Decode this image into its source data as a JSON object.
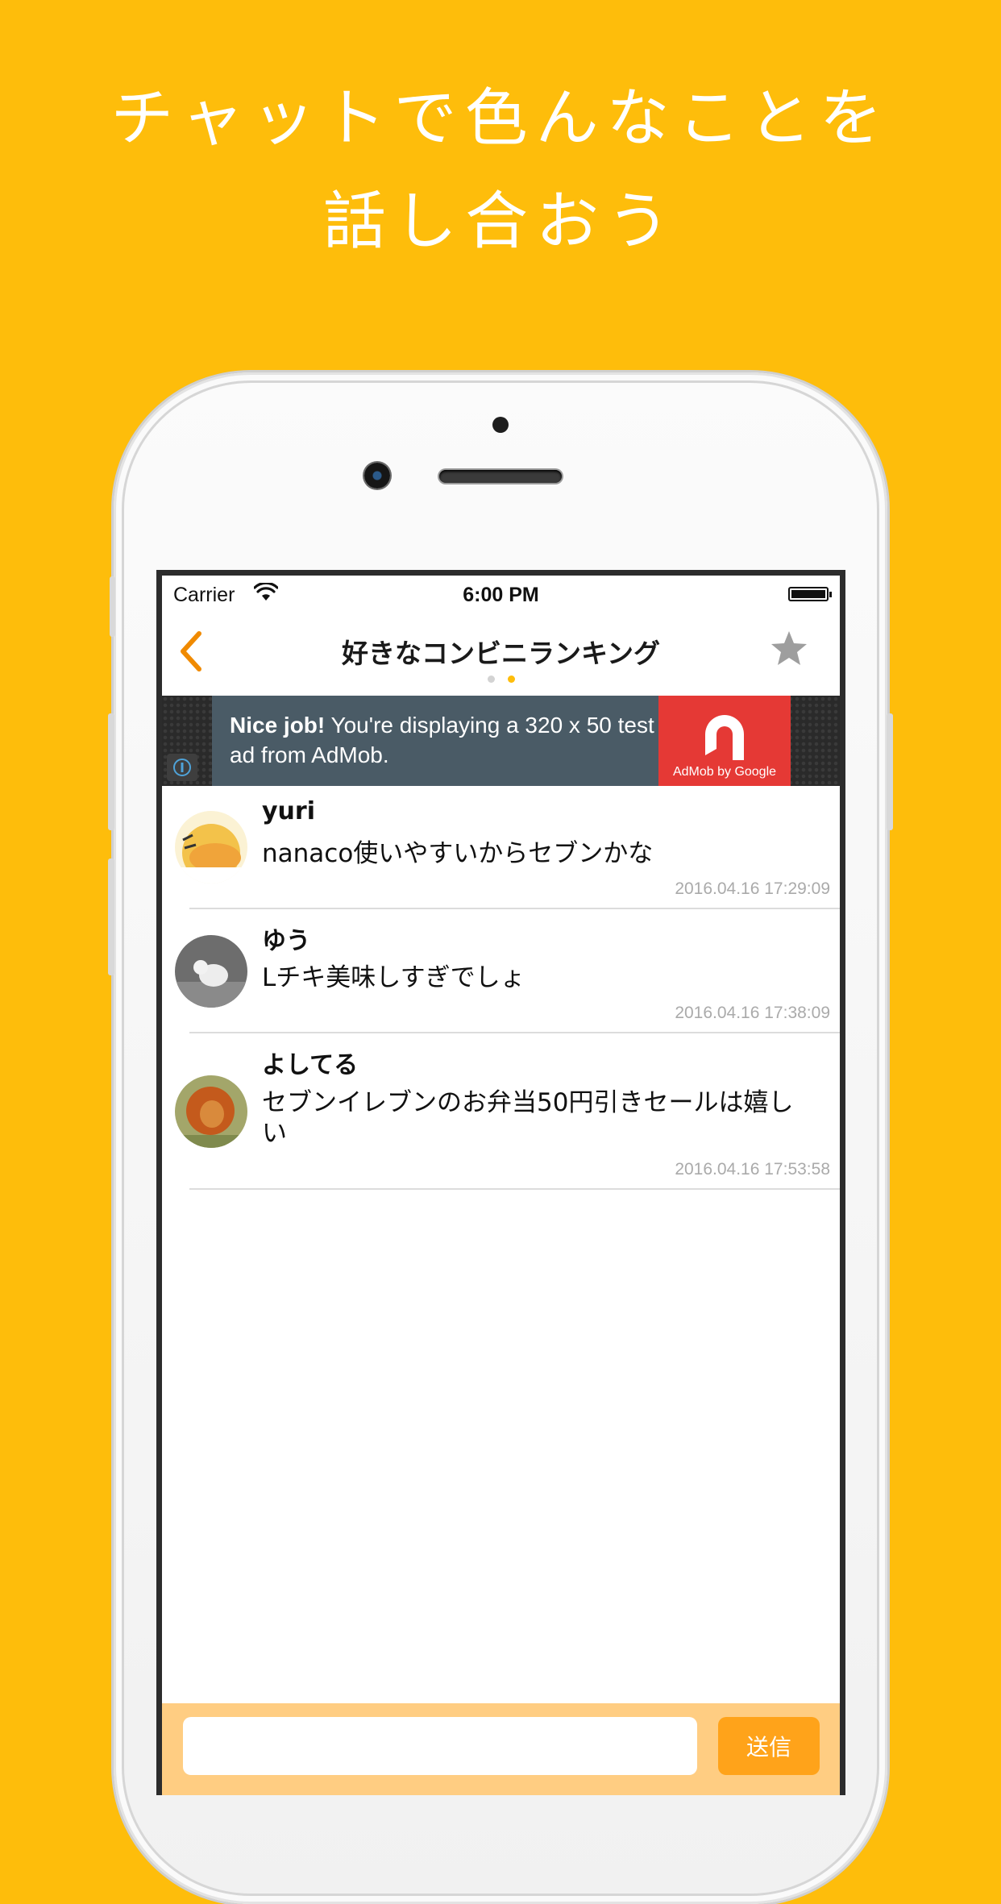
{
  "headline": {
    "line1": "チャットで色んなことを",
    "line2": "話し合おう"
  },
  "colors": {
    "background": "#FEBD0B",
    "accent": "#F08A00",
    "input_bar": "#FFCD82",
    "send_button": "#FFA31A",
    "ad_red": "#E53935"
  },
  "status_bar": {
    "carrier": "Carrier",
    "time": "6:00 PM"
  },
  "nav": {
    "back_icon": "chevron-left-icon",
    "title": "好きなコンビニランキング",
    "favorite_icon": "star-icon",
    "page_indicator": {
      "count": 2,
      "active_index": 1
    }
  },
  "ad": {
    "headline_bold": "Nice job!",
    "body": " You're displaying a 320 x 50 test ad from AdMob.",
    "brand": "AdMob by Google"
  },
  "messages": [
    {
      "user": "yuri",
      "text": "nanaco使いやすいからセブンかな",
      "timestamp": "2016.04.16 17:29:09"
    },
    {
      "user": "ゆう",
      "text": "Lチキ美味しすぎでしょ",
      "timestamp": "2016.04.16 17:38:09"
    },
    {
      "user": "よしてる",
      "text": "セブンイレブンのお弁当50円引きセールは嬉しい",
      "timestamp": "2016.04.16 17:53:58"
    }
  ],
  "composer": {
    "placeholder": "",
    "send_label": "送信"
  }
}
